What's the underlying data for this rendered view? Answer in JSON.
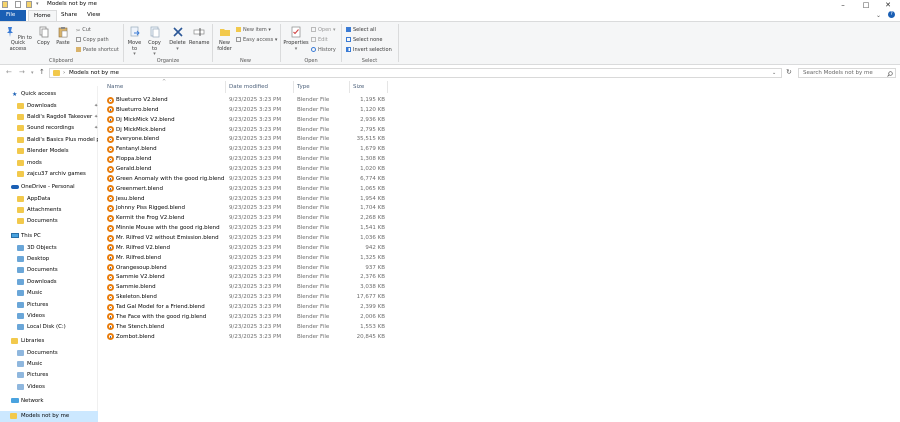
{
  "window": {
    "title": "Models not by me",
    "controls": {
      "minimize": "–",
      "maximize": "□",
      "close": "✕"
    }
  },
  "ribbon_tabs": [
    "File",
    "Home",
    "Share",
    "View"
  ],
  "ribbon": {
    "clipboard": {
      "pin": "Pin to Quick access",
      "copy": "Copy",
      "paste": "Paste",
      "cut": "Cut",
      "copy_path": "Copy path",
      "paste_shortcut": "Paste shortcut",
      "label": "Clipboard"
    },
    "organize": {
      "move_to": "Move to",
      "copy_to": "Copy to",
      "delete": "Delete",
      "rename": "Rename",
      "label": "Organize"
    },
    "new": {
      "new_folder": "New folder",
      "new_item": "New item",
      "easy_access": "Easy access",
      "label": "New"
    },
    "open": {
      "properties": "Properties",
      "open": "Open",
      "edit": "Edit",
      "history": "History",
      "label": "Open"
    },
    "select": {
      "select_all": "Select all",
      "select_none": "Select none",
      "invert_selection": "Invert selection",
      "label": "Select"
    }
  },
  "address": {
    "path": "Models not by me",
    "search_placeholder": "Search Models not by me"
  },
  "sidebar": {
    "quick_access": "Quick access",
    "items": [
      {
        "label": "Downloads",
        "pinned": true
      },
      {
        "label": "Baldi's Ragdoll Takeover",
        "pinned": true
      },
      {
        "label": "Sound recordings",
        "pinned": true
      },
      {
        "label": "Baldi's Basics Plus model pack",
        "pinned": false
      },
      {
        "label": "Blender Models",
        "pinned": false
      },
      {
        "label": "mods",
        "pinned": false
      },
      {
        "label": "zajcu37 archiv games",
        "pinned": false
      }
    ],
    "onedrive": "OneDrive - Personal",
    "onedrive_items": [
      "AppData",
      "Attachments",
      "Documents"
    ],
    "this_pc": "This PC",
    "pc_items": [
      "3D Objects",
      "Desktop",
      "Documents",
      "Downloads",
      "Music",
      "Pictures",
      "Videos",
      "Local Disk (C:)"
    ],
    "libraries": "Libraries",
    "library_items": [
      "Documents",
      "Music",
      "Pictures",
      "Videos"
    ],
    "network": "Network",
    "selected": "Models not by me"
  },
  "columns": {
    "name": "Name",
    "date": "Date modified",
    "type": "Type",
    "size": "Size"
  },
  "files": [
    {
      "name": "Blueturro V2.blend",
      "date": "9/23/2025 3:23 PM",
      "type": "Blender File",
      "size": "1,195 KB"
    },
    {
      "name": "Blueturro.blend",
      "date": "9/23/2025 3:23 PM",
      "type": "Blender File",
      "size": "1,120 KB"
    },
    {
      "name": "Dj MickMick V2.blend",
      "date": "9/23/2025 3:23 PM",
      "type": "Blender File",
      "size": "2,936 KB"
    },
    {
      "name": "Dj MickMick.blend",
      "date": "9/23/2025 3:23 PM",
      "type": "Blender File",
      "size": "2,795 KB"
    },
    {
      "name": "Everyone.blend",
      "date": "9/23/2025 3:23 PM",
      "type": "Blender File",
      "size": "35,515 KB"
    },
    {
      "name": "Fentanyl.blend",
      "date": "9/23/2025 3:23 PM",
      "type": "Blender File",
      "size": "1,679 KB"
    },
    {
      "name": "Floppa.blend",
      "date": "9/23/2025 3:23 PM",
      "type": "Blender File",
      "size": "1,308 KB"
    },
    {
      "name": "Gerald.blend",
      "date": "9/23/2025 3:23 PM",
      "type": "Blender File",
      "size": "1,020 KB"
    },
    {
      "name": "Green Anomaly with the good rig.blend",
      "date": "9/23/2025 3:23 PM",
      "type": "Blender File",
      "size": "6,774 KB"
    },
    {
      "name": "Greenmert.blend",
      "date": "9/23/2025 3:23 PM",
      "type": "Blender File",
      "size": "1,065 KB"
    },
    {
      "name": "Jesu.blend",
      "date": "9/23/2025 3:23 PM",
      "type": "Blender File",
      "size": "1,954 KB"
    },
    {
      "name": "Johnny Piss Rigged.blend",
      "date": "9/23/2025 3:23 PM",
      "type": "Blender File",
      "size": "1,704 KB"
    },
    {
      "name": "Kermit the Frog V2.blend",
      "date": "9/23/2025 3:23 PM",
      "type": "Blender File",
      "size": "2,268 KB"
    },
    {
      "name": "Minnie Mouse with the good rig.blend",
      "date": "9/23/2025 3:23 PM",
      "type": "Blender File",
      "size": "1,541 KB"
    },
    {
      "name": "Mr. Rilfred V2 without Emission.blend",
      "date": "9/23/2025 3:23 PM",
      "type": "Blender File",
      "size": "1,036 KB"
    },
    {
      "name": "Mr. Rilfred V2.blend",
      "date": "9/23/2025 3:23 PM",
      "type": "Blender File",
      "size": "942 KB"
    },
    {
      "name": "Mr. Rilfred.blend",
      "date": "9/23/2025 3:23 PM",
      "type": "Blender File",
      "size": "1,325 KB"
    },
    {
      "name": "Orangesoup.blend",
      "date": "9/23/2025 3:23 PM",
      "type": "Blender File",
      "size": "937 KB"
    },
    {
      "name": "Sammie V2.blend",
      "date": "9/23/2025 3:23 PM",
      "type": "Blender File",
      "size": "2,376 KB"
    },
    {
      "name": "Sammie.blend",
      "date": "9/23/2025 3:23 PM",
      "type": "Blender File",
      "size": "3,038 KB"
    },
    {
      "name": "Skeleton.blend",
      "date": "9/23/2025 3:23 PM",
      "type": "Blender File",
      "size": "17,677 KB"
    },
    {
      "name": "Tad Gal Model for a Friend.blend",
      "date": "9/23/2025 3:23 PM",
      "type": "Blender File",
      "size": "2,399 KB"
    },
    {
      "name": "The Face with the good rig.blend",
      "date": "9/23/2025 3:23 PM",
      "type": "Blender File",
      "size": "2,006 KB"
    },
    {
      "name": "The Stench.blend",
      "date": "9/23/2025 3:23 PM",
      "type": "Blender File",
      "size": "1,553 KB"
    },
    {
      "name": "Zombot.blend",
      "date": "9/23/2025 3:23 PM",
      "type": "Blender File",
      "size": "20,845 KB"
    }
  ],
  "colors": {
    "accent": "#1a5fb4",
    "selected_bg": "#cce8ff",
    "folder": "#f2c94c",
    "blend_icon": "#e87d0d"
  }
}
